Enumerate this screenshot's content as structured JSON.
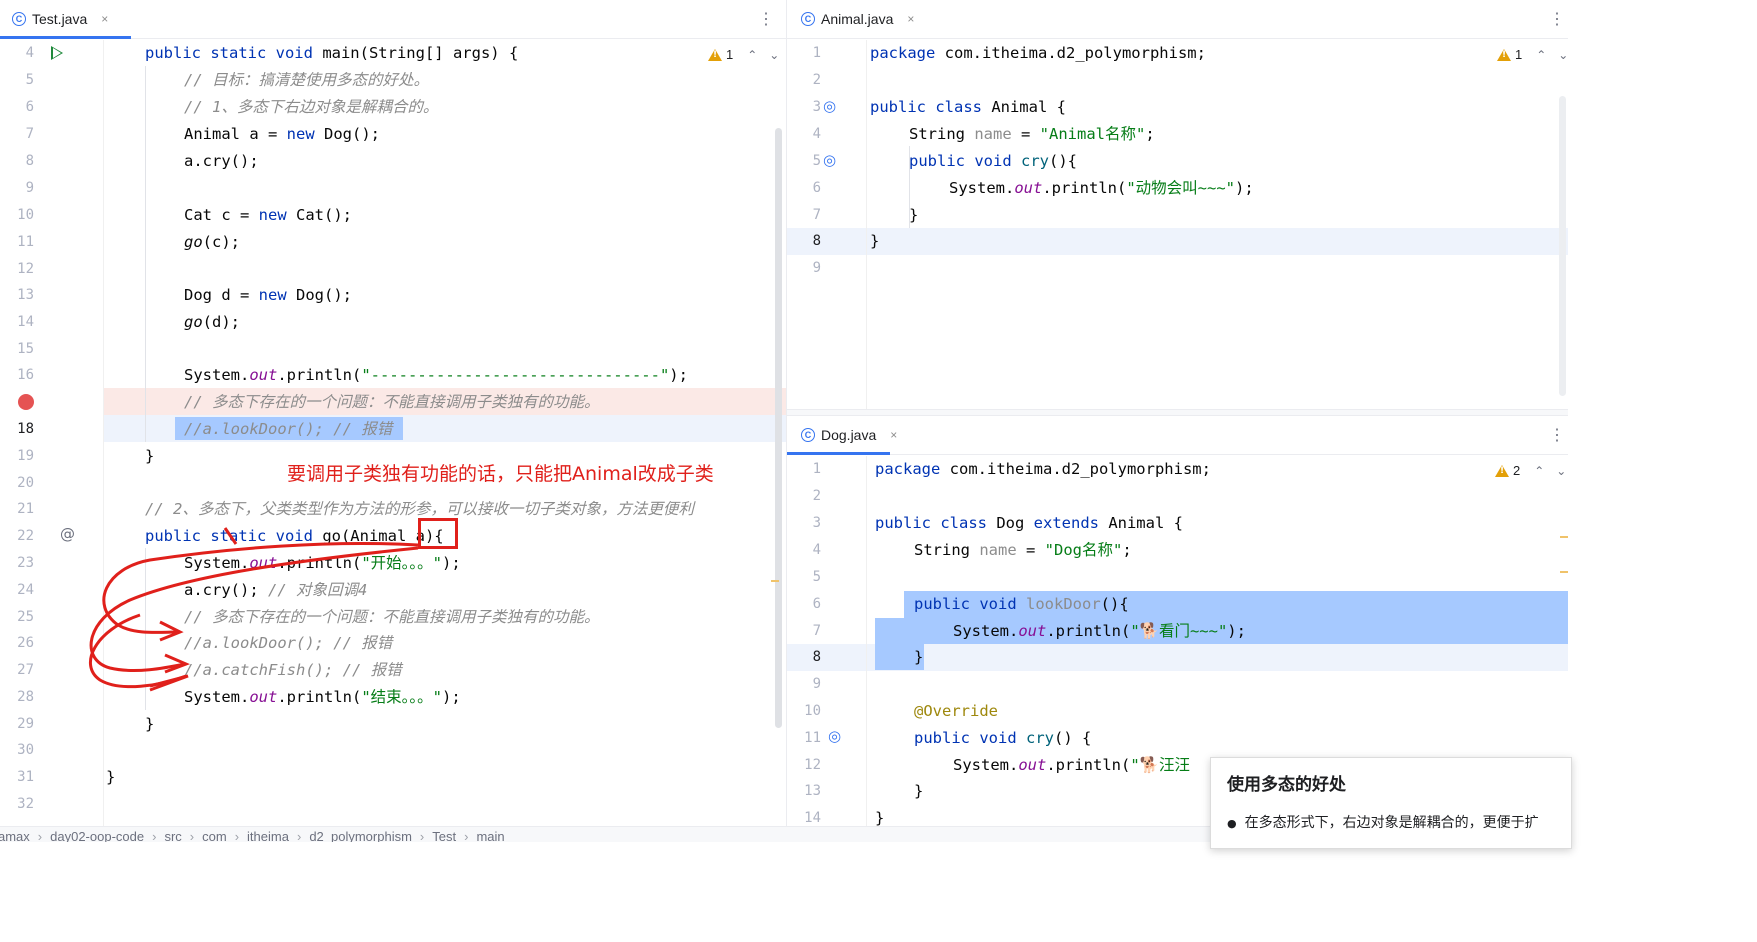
{
  "left_pane": {
    "tab": {
      "label": "Test.java",
      "icon": "class-icon",
      "close": "×"
    },
    "menu": "⋮",
    "inspection": {
      "count": "1"
    },
    "lines": [
      {
        "n": "4",
        "code": ""
      },
      {
        "n": "5",
        "comment": "// 目标：搞清楚使用多态的好处。"
      },
      {
        "n": "6",
        "comment": "// 1、多态下右边对象是解耦合的。"
      },
      {
        "n": "7"
      },
      {
        "n": "8"
      },
      {
        "n": "9"
      },
      {
        "n": "10"
      },
      {
        "n": "11"
      },
      {
        "n": "12"
      },
      {
        "n": "13"
      },
      {
        "n": "14"
      },
      {
        "n": "15"
      },
      {
        "n": "16"
      },
      {
        "n": "",
        "comment": "// 多态下存在的一个问题：不能直接调用子类独有的功能。"
      },
      {
        "n": "18",
        "comment": "//a.lookDoor(); // 报错"
      },
      {
        "n": "19"
      },
      {
        "n": "20"
      },
      {
        "n": "21",
        "comment": "// 2、多态下，父类类型作为方法的形参，可以接收一切子类对象，方法更便利"
      },
      {
        "n": "22"
      },
      {
        "n": "23"
      },
      {
        "n": "24",
        "comment": "// 对象回调4"
      },
      {
        "n": "25",
        "comment": "// 多态下存在的一个问题：不能直接调用子类独有的功能。"
      },
      {
        "n": "26",
        "comment": "//a.lookDoor(); // 报错"
      },
      {
        "n": "27",
        "comment": "//a.catchFish(); // 报错"
      },
      {
        "n": "28"
      },
      {
        "n": "29"
      },
      {
        "n": "30"
      },
      {
        "n": "31"
      },
      {
        "n": "32"
      }
    ],
    "strings": {
      "dashes": "\"-------------------------------\"",
      "start": "\"开始。。。\"",
      "end": "\"结束。。。\""
    },
    "annotation": "要调用子类独有功能的话，只能把Animal改成子类"
  },
  "animal_pane": {
    "tab": {
      "label": "Animal.java",
      "icon": "class-icon",
      "close": "×"
    },
    "menu": "⋮",
    "inspection": {
      "count": "1"
    },
    "line_numbers": [
      "1",
      "2",
      "3",
      "4",
      "5",
      "6",
      "7",
      "8",
      "9"
    ],
    "package": "com.itheima.d2_polymorphism",
    "name_value": "\"Animal名称\"",
    "cry_text": "\"动物会叫~~~\""
  },
  "dog_pane": {
    "tab": {
      "label": "Dog.java",
      "icon": "class-icon",
      "close": "×"
    },
    "menu": "⋮",
    "inspection": {
      "count": "2"
    },
    "line_numbers": [
      "1",
      "2",
      "3",
      "4",
      "5",
      "6",
      "7",
      "8",
      "9",
      "10",
      "11",
      "12",
      "13",
      "14"
    ],
    "package": "com.itheima.d2_polymorphism",
    "name_value": "\"Dog名称\"",
    "look_text": "\"🐕看门~~~\"",
    "cry_text": "\"🐕汪汪"
  },
  "popup": {
    "title": "使用多态的好处",
    "bullet": "在多态形式下，右边对象是解耦合的，更便于扩"
  },
  "breadcrumbs": [
    "amax",
    "day02-oop-code",
    "src",
    "com",
    "itheima",
    "d2_polymorphism",
    "Test",
    "main"
  ],
  "colors": {
    "keyword": "#0033b3",
    "string": "#067d17",
    "comment": "#8c8c8c",
    "field": "#871094",
    "annotation_red": "#e0201b",
    "selection": "#a6c9ff",
    "accent": "#3574f0"
  }
}
